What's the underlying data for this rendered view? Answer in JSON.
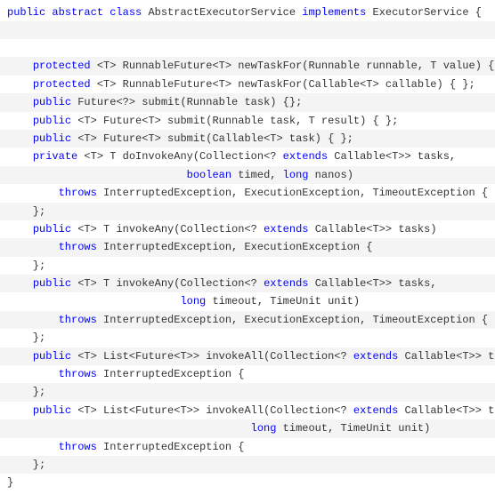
{
  "code": {
    "line1_public": "public",
    "line1_abstract": "abstract",
    "line1_class": "class",
    "line1_classname": " AbstractExecutorService ",
    "line1_implements": "implements",
    "line1_interface": " ExecutorService {",
    "line2_protected": "protected",
    "line2_rest": " <T> RunnableFuture<T> newTaskFor(Runnable runnable, T value) { };",
    "line3_protected": "protected",
    "line3_rest": " <T> RunnableFuture<T> newTaskFor(Callable<T> callable) { };",
    "line4_public": "public",
    "line4_rest": " Future<?> submit(Runnable task) {};",
    "line5_public": "public",
    "line5_rest": " <T> Future<T> submit(Runnable task, T result) { };",
    "line6_public": "public",
    "line6_rest": " <T> Future<T> submit(Callable<T> task) { };",
    "line7_private": "private",
    "line7_mid": " <T> T doInvokeAny(Collection<? ",
    "line7_extends": "extends",
    "line7_end": " Callable<T>> tasks,",
    "line8_boolean": "boolean",
    "line8_mid": " timed, ",
    "line8_long": "long",
    "line8_end": " nanos)",
    "line9_throws": "throws",
    "line9_rest": " InterruptedException, ExecutionException, TimeoutException {",
    "line10": "    };",
    "line11_public": "public",
    "line11_mid": " <T> T invokeAny(Collection<? ",
    "line11_extends": "extends",
    "line11_end": " Callable<T>> tasks)",
    "line12_throws": "throws",
    "line12_rest": " InterruptedException, ExecutionException {",
    "line13": "    };",
    "line14_public": "public",
    "line14_mid": " <T> T invokeAny(Collection<? ",
    "line14_extends": "extends",
    "line14_end": " Callable<T>> tasks,",
    "line15_long": "long",
    "line15_rest": " timeout, TimeUnit unit)",
    "line16_throws": "throws",
    "line16_rest": " InterruptedException, ExecutionException, TimeoutException {",
    "line17": "    };",
    "line18_public": "public",
    "line18_mid": " <T> List<Future<T>> invokeAll(Collection<? ",
    "line18_extends": "extends",
    "line18_end": " Callable<T>> tasks)",
    "line19_throws": "throws",
    "line19_rest": " InterruptedException {",
    "line20": "    };",
    "line21_public": "public",
    "line21_mid": " <T> List<Future<T>> invokeAll(Collection<? ",
    "line21_extends": "extends",
    "line21_end": " Callable<T>> tasks,",
    "line22_long": "long",
    "line22_rest": " timeout, TimeUnit unit)",
    "line23_throws": "throws",
    "line23_rest": " InterruptedException {",
    "line24": "    };",
    "line25": "}"
  }
}
